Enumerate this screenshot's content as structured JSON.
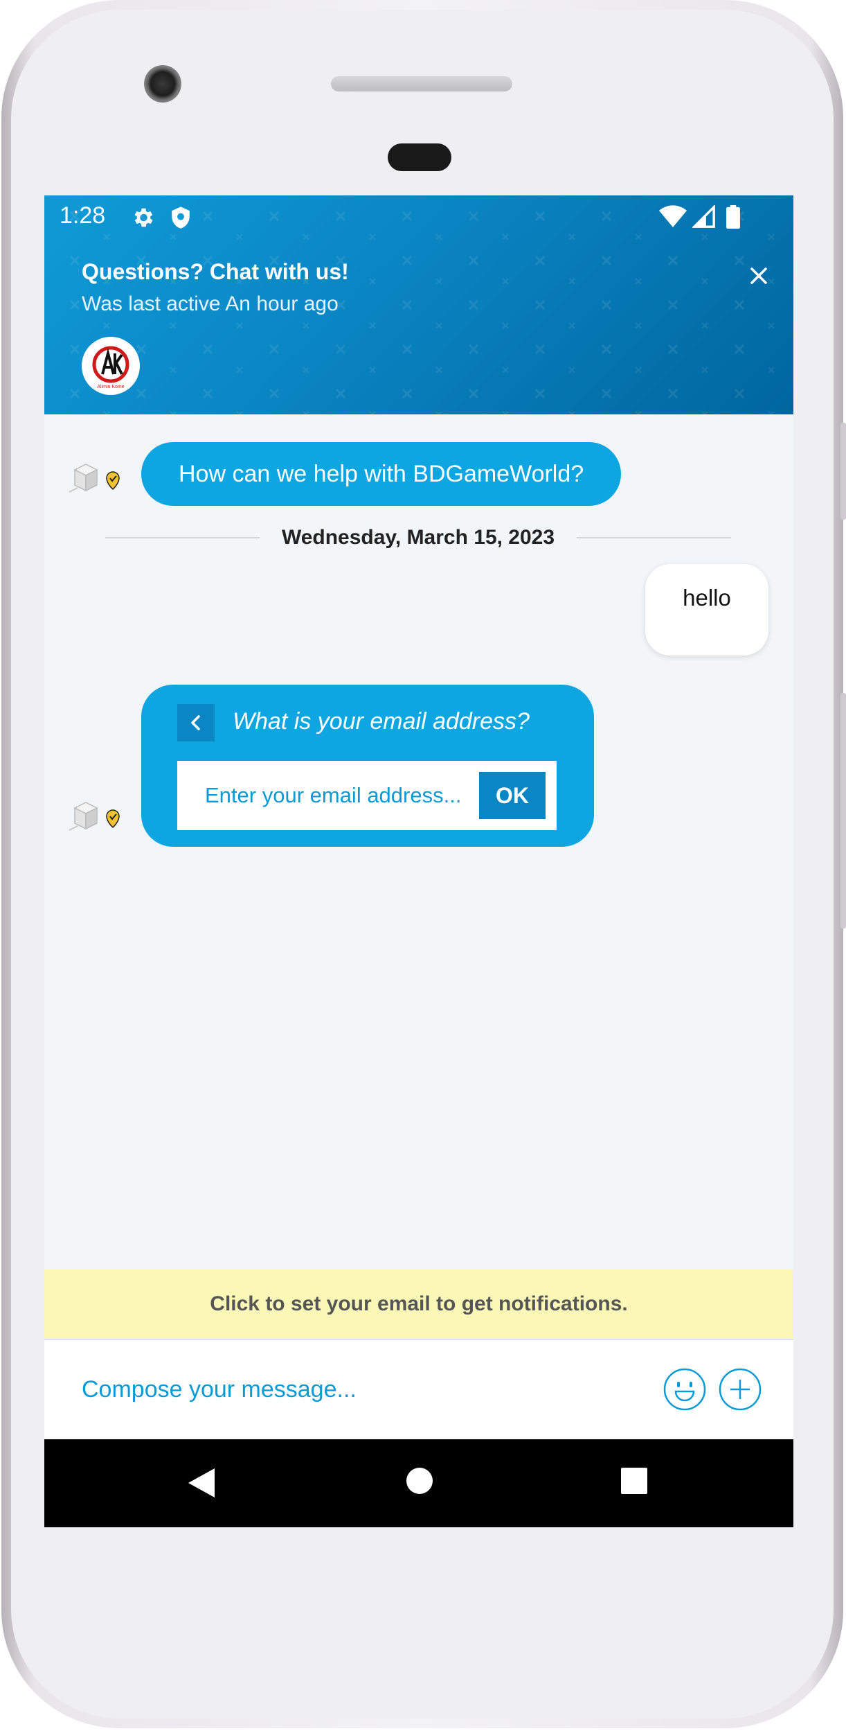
{
  "status_bar": {
    "time": "1:28",
    "left_icons": [
      "gear-icon",
      "shield-icon"
    ],
    "right_icons": [
      "wifi-icon",
      "signal-icon",
      "battery-icon"
    ]
  },
  "header": {
    "title": "Questions? Chat with us!",
    "subtitle": "Was last active An hour ago",
    "close_icon": "close-icon",
    "brand_logo_text": "Alimin Kome",
    "colors": {
      "gradient_start": "#0f9bd7",
      "gradient_end": "#00669e"
    }
  },
  "conversation": {
    "bot_greeting": "How can we help with BDGameWorld?",
    "date_divider": "Wednesday, March 15, 2023",
    "user_message": "hello",
    "email_prompt": {
      "question": "What is your email address?",
      "placeholder": "Enter your email address...",
      "ok_label": "OK"
    },
    "colors": {
      "bubble": "#0ea6e0",
      "button": "#0b86c5"
    }
  },
  "notification_bar": {
    "text": "Click to set your email to get notifications.",
    "color": "#fbf8b7"
  },
  "composer": {
    "placeholder": "Compose your message...",
    "emoji_icon": "emoji-icon",
    "add_icon": "plus-icon"
  },
  "nav_bar": {
    "buttons": [
      "back-triangle-icon",
      "home-circle-icon",
      "recents-square-icon"
    ]
  }
}
